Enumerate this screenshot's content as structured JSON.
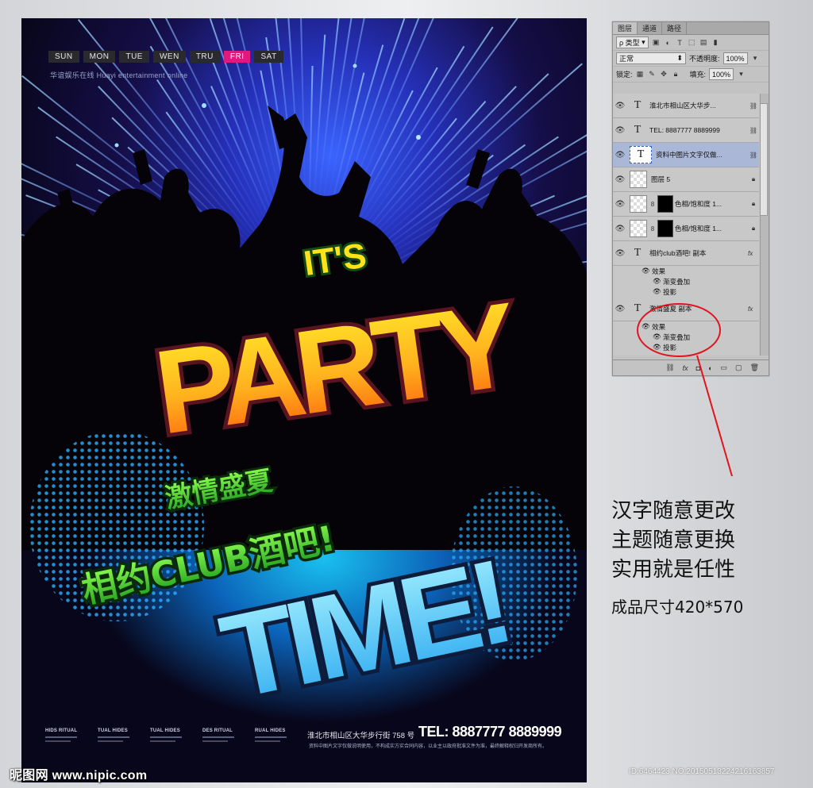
{
  "poster": {
    "days": [
      "SUN",
      "MON",
      "TUE",
      "WEN",
      "TRU",
      "FRI",
      "SAT"
    ],
    "active_day": "FRI",
    "brand": "华谊娱乐在线  Huayi entertainment online",
    "title_its": "IT'S",
    "title_party": "PARTY",
    "title_time": "TIME!",
    "subtitle_1": "激情盛夏",
    "subtitle_2": "相约CLUB酒吧!",
    "footer_cols": [
      "HIDS RITUAL",
      "TUAL HIDES",
      "TUAL HIDES",
      "DES RITUAL",
      "RUAL HIDES"
    ],
    "address": "淮北市相山区大华步行街 758 号",
    "tel": "TEL: 8887777 8889999",
    "disclaimer": "资料中图片文字仅做说明使用，不构成实方实合同内容，以业主以政府批准文件为准，最终解释权归开发商所有。"
  },
  "watermark": "昵图网 www.nipic.com",
  "image_id": "ID:6464423 NO:20150513224216163857",
  "layers_panel": {
    "tabs": [
      "图层",
      "通道",
      "路径"
    ],
    "active_tab": "图层",
    "filter_label": "ρ 类型",
    "blend_mode": "正常",
    "opacity_label": "不透明度:",
    "opacity_value": "100%",
    "lock_label": "锁定:",
    "fill_label": "填充:",
    "fill_value": "100%",
    "layers": [
      {
        "name": "淮北市相山区大华步...",
        "kind": "text",
        "right": "link"
      },
      {
        "name": "TEL: 8887777  8889999",
        "kind": "text",
        "right": "link"
      },
      {
        "name": "资料中图片文字仅做...",
        "kind": "text-selected",
        "right": "link"
      },
      {
        "name": "图层 5",
        "kind": "pixel",
        "right": "lock"
      },
      {
        "name": "色相/饱和度 1...",
        "kind": "adjust",
        "right": "lock"
      },
      {
        "name": "色相/饱和度 1...",
        "kind": "adjust",
        "right": "lock"
      },
      {
        "name": "相约club酒吧! 副本",
        "kind": "text",
        "right": "fx"
      },
      {
        "name": "激情盛夏  副本",
        "kind": "text",
        "right": "fx"
      }
    ],
    "effects_label": "效果",
    "effect_1": "渐变叠加",
    "effect_2": "投影"
  },
  "annotation": {
    "line1": "汉字随意更改",
    "line2": "主题随意更换",
    "line3": "实用就是任性",
    "line4": "成品尺寸420*570"
  },
  "colors": {
    "accent_pink": "#e0197e",
    "party_yellow": "#ffe21a",
    "party_orange": "#ff6a10",
    "time_cyan": "#7de8ff",
    "sub_green": "#3ddc2c",
    "annot_red": "#e0141e"
  }
}
